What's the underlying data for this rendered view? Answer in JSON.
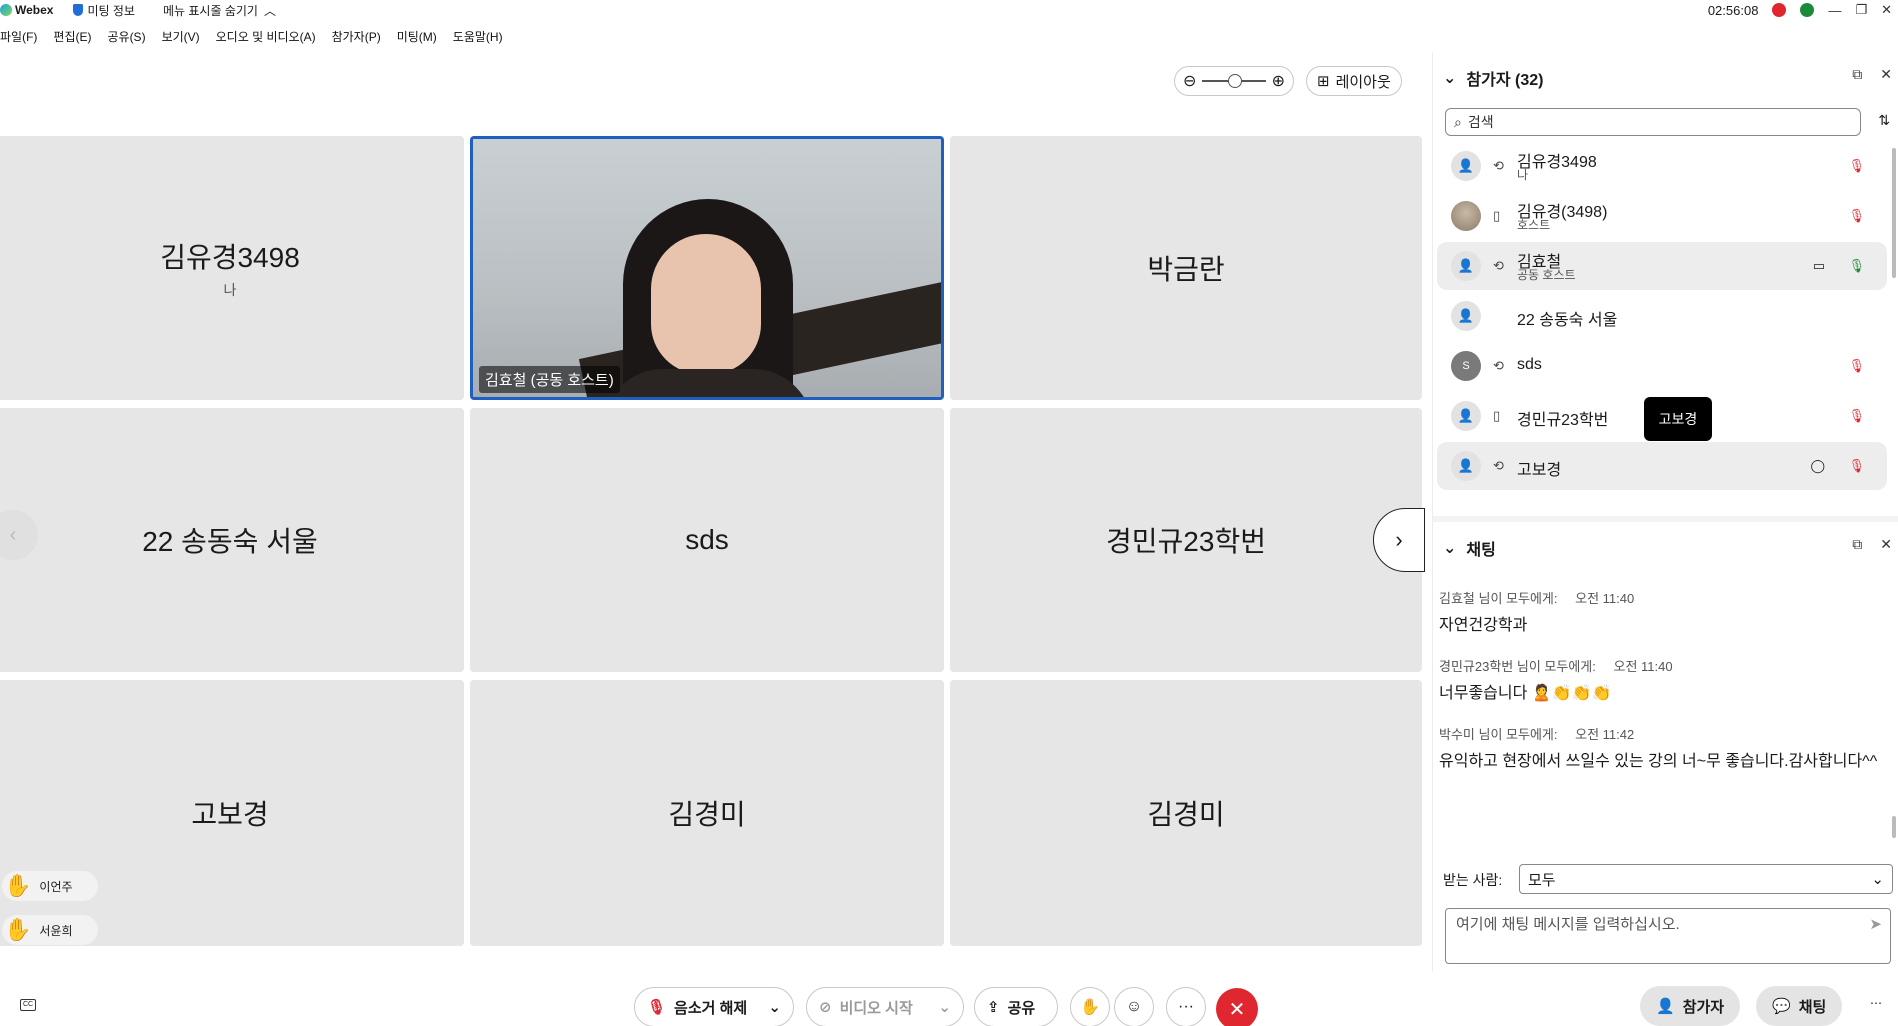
{
  "titlebar": {
    "app": "Webex",
    "meeting_info": "미팅 정보",
    "hide_menu": "메뉴 표시줄 숨기기",
    "time": "02:56:08"
  },
  "menu": {
    "items": [
      "파일(F)",
      "편집(E)",
      "공유(S)",
      "보기(V)",
      "오디오 및 비디오(A)",
      "참가자(P)",
      "미팅(M)",
      "도움말(H)"
    ]
  },
  "toolbar": {
    "layout_label": "레이아웃",
    "zoom_level": 0.4
  },
  "grid": {
    "tiles": [
      {
        "name": "김유경3498",
        "sub": "나"
      },
      {
        "name": "김효철 (공동 호스트)"
      },
      {
        "name": "박금란"
      },
      {
        "name": "22 송동숙 서울"
      },
      {
        "name": "sds"
      },
      {
        "name": "경민규23학번"
      },
      {
        "name": "고보경"
      },
      {
        "name": "김경미"
      },
      {
        "name": "김경미"
      }
    ],
    "raised_hands": [
      "이언주",
      "서윤희"
    ]
  },
  "controls": {
    "unmute": "음소거 해제",
    "start_video": "비디오 시작",
    "share": "공유",
    "more": "···",
    "participants": "참가자",
    "chat": "채팅"
  },
  "participants_panel": {
    "title": "참가자 (32)",
    "search_placeholder": "검색",
    "rows": [
      {
        "name": "김유경3498",
        "role": "나"
      },
      {
        "name": "김유경(3498)",
        "role": "호스트"
      },
      {
        "name": "김효철",
        "role": "공동 호스트"
      },
      {
        "name": "22 송동숙 서울",
        "role": ""
      },
      {
        "name": "sds",
        "role": "",
        "initial": "S"
      },
      {
        "name": "경민규23학번",
        "role": ""
      },
      {
        "name": "고보경",
        "role": ""
      }
    ],
    "tooltip": "고보경"
  },
  "chat_panel": {
    "title": "채팅",
    "messages": [
      {
        "sender": "김효철 님이 모두에게:",
        "time": "오전 11:40",
        "text": "자연건강학과"
      },
      {
        "sender": "경민규23학번 님이 모두에게:",
        "time": "오전 11:40",
        "text": "너무좋습니다 🙎👏👏👏"
      },
      {
        "sender": "박수미 님이 모두에게:",
        "time": "오전 11:42",
        "text": "유익하고 현장에서 쓰일수 있는 강의 너~무 좋습니다.감사합니다^^"
      }
    ],
    "to_label": "받는 사람:",
    "to_value": "모두",
    "input_placeholder": "여기에 채팅 메시지를 입력하십시오."
  },
  "colors": {
    "accent": "#1f5fbf",
    "end_call": "#e0262f",
    "tile_bg": "#e6e6e6"
  }
}
